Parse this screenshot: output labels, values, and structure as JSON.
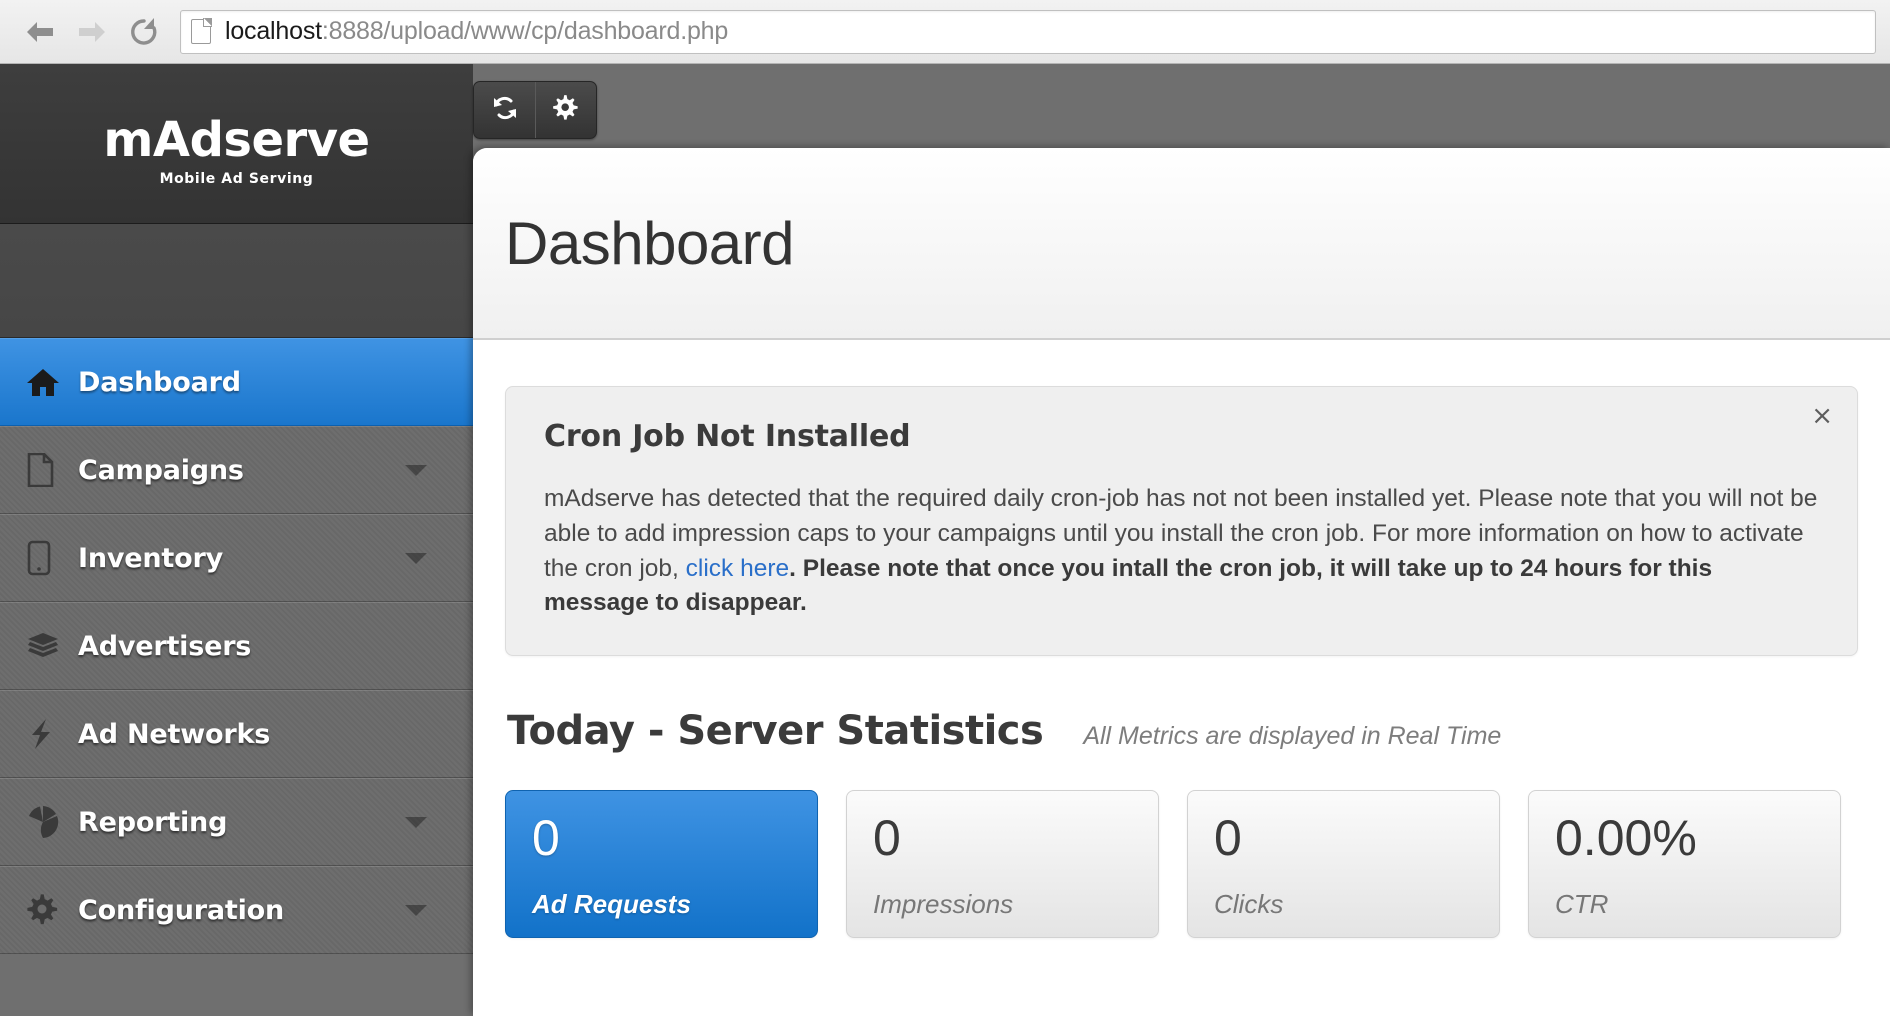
{
  "browser": {
    "back_icon": "back-arrow-icon",
    "forward_icon": "forward-arrow-icon",
    "reload_icon": "reload-icon",
    "page_icon": "page-document-icon",
    "url_host": "localhost",
    "url_path": ":8888/upload/www/cp/dashboard.php"
  },
  "brand": {
    "name": "mAdserve",
    "tagline": "Mobile Ad Serving"
  },
  "toolbar": {
    "buttons": [
      {
        "name": "refresh-button",
        "icon": "sync-refresh-icon"
      },
      {
        "name": "settings-button",
        "icon": "gear-icon"
      }
    ]
  },
  "sidebar": {
    "items": [
      {
        "label": "Dashboard",
        "icon": "home-icon",
        "active": true,
        "caret": false
      },
      {
        "label": "Campaigns",
        "icon": "document-icon",
        "active": false,
        "caret": true
      },
      {
        "label": "Inventory",
        "icon": "mobile-icon",
        "active": false,
        "caret": true
      },
      {
        "label": "Advertisers",
        "icon": "stack-icon",
        "active": false,
        "caret": false
      },
      {
        "label": "Ad Networks",
        "icon": "bolt-icon",
        "active": false,
        "caret": false
      },
      {
        "label": "Reporting",
        "icon": "pie-chart-icon",
        "active": false,
        "caret": true
      },
      {
        "label": "Configuration",
        "icon": "gear-icon",
        "active": false,
        "caret": true
      }
    ]
  },
  "page": {
    "title": "Dashboard"
  },
  "alert": {
    "title": "Cron Job Not Installed",
    "close_label": "×",
    "text_before_link": "mAdserve has detected that the required daily cron-job has not not been installed yet. Please note that you will not be able to add impression caps to your campaigns until you install the cron job. For more information on how to activate the cron job, ",
    "link_label": "click here",
    "text_after_link": ". Please note that once you intall the cron job, it will take up to 24 hours for this message to disappear."
  },
  "stats": {
    "title": "Today - Server Statistics",
    "subtitle": "All Metrics are displayed in Real Time",
    "cards": [
      {
        "value": "0",
        "name": "Ad Requests",
        "active": true
      },
      {
        "value": "0",
        "name": "Impressions",
        "active": false
      },
      {
        "value": "0",
        "name": "Clicks",
        "active": false
      },
      {
        "value": "0.00%",
        "name": "CTR",
        "active": false
      }
    ]
  },
  "colors": {
    "accent_blue": "#1a76cc",
    "sidebar_gray": "#6b6b6b",
    "header_dark": "#333333",
    "link_blue": "#2a6fc9"
  }
}
